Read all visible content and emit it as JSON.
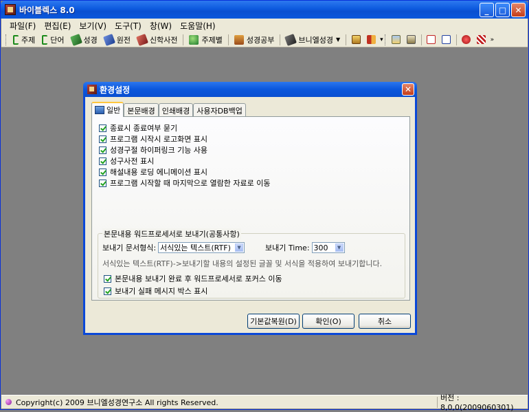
{
  "window": {
    "title": "바이블렉스 8.0",
    "controls": {
      "minimize": "_",
      "maximize": "□",
      "close": "✕"
    }
  },
  "menu": [
    "파일(F)",
    "편집(E)",
    "보기(V)",
    "도구(T)",
    "창(W)",
    "도움말(H)"
  ],
  "toolbar": {
    "buttons": [
      {
        "label": "주제",
        "icon": "green-bracket-icon",
        "color": "#1a8a1a"
      },
      {
        "label": "단어",
        "icon": "green-bracket-icon",
        "color": "#1a8a1a"
      },
      {
        "label": "성경",
        "icon": "book-icon",
        "color": "#2f7a2f"
      },
      {
        "label": "원전",
        "icon": "book-icon",
        "color": "#2b4fa8"
      },
      {
        "label": "신학사전",
        "icon": "book-icon",
        "color": "#a02a2a"
      },
      {
        "label": "주제별",
        "icon": "people-icon",
        "color": "#2a8a3a"
      },
      {
        "label": "성경공부",
        "icon": "book-stack-icon",
        "color": "#9a4a1a"
      },
      {
        "label": "브니엘성경",
        "icon": "book-icon",
        "color": "#3a3a3a"
      }
    ],
    "overflow": "»"
  },
  "dialog": {
    "title": "환경설정",
    "close": "✕",
    "tabs": [
      "일반",
      "본문배경",
      "인쇄배경",
      "사용자DB백업"
    ],
    "options": [
      {
        "label": "종료시 종료여부 묻기",
        "checked": true
      },
      {
        "label": "프로그램 시작시 로고화면 표시",
        "checked": true
      },
      {
        "label": "성경구절 하이퍼링크 기능 사용",
        "checked": true
      },
      {
        "label": "성구사전 표시",
        "checked": true
      },
      {
        "label": "해설내용 로딩 에니메이션 표시",
        "checked": true
      },
      {
        "label": "프로그램 시작할 때 마지막으로 열람한 자료로 이동",
        "checked": true
      }
    ],
    "export_group": {
      "title": "본문내용 워드프로세서로 보내기(공통사항)",
      "format_label": "보내기 문서형식:",
      "format_value": "서식있는 텍스트(RTF)",
      "time_label": "보내기 Time:",
      "time_value": "300",
      "hint": "서식있는 텍스트(RTF)->보내기할 내용의 설정된 글꼴 및 서식을 적용하여 보내기합니다.",
      "options": [
        {
          "label": "본문내용 보내기 완료 후 워드프로세서로 포커스 이동",
          "checked": true
        },
        {
          "label": "보내기 실패 메시지 박스 표시",
          "checked": true
        }
      ]
    },
    "buttons": {
      "defaults": "기본값복원(D)",
      "ok": "확인(O)",
      "cancel": "취소"
    }
  },
  "status": {
    "copyright": "Copyright(c) 2009 브니엘성경연구소 All rights Reserved.",
    "version": "버전 : 8,0,0(2009060301)"
  }
}
